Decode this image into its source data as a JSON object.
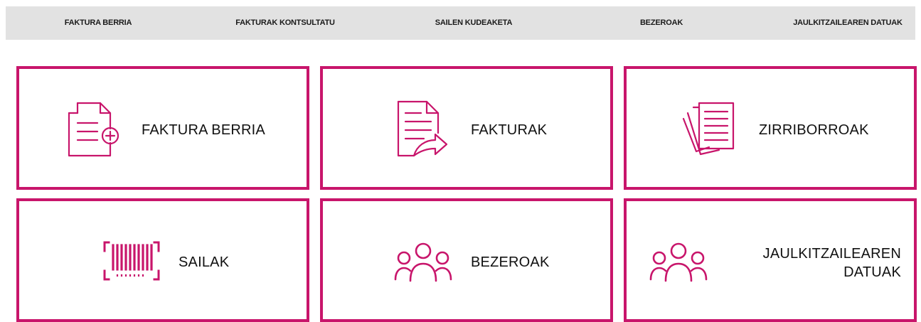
{
  "nav": {
    "items": [
      {
        "label": "FAKTURA BERRIA"
      },
      {
        "label": "FAKTURAK KONTSULTATU"
      },
      {
        "label": "SAILEN KUDEAKETA"
      },
      {
        "label": "BEZEROAK"
      },
      {
        "label": "JAULKITZAILEAREN DATUAK"
      }
    ]
  },
  "cards": [
    {
      "label": "FAKTURA BERRIA",
      "icon": "new-invoice-icon"
    },
    {
      "label": "FAKTURAK",
      "icon": "invoice-send-icon"
    },
    {
      "label": "ZIRRIBORROAK",
      "icon": "drafts-icon"
    },
    {
      "label": "SAILAK",
      "icon": "barcode-icon"
    },
    {
      "label": "BEZEROAK",
      "icon": "customers-icon"
    },
    {
      "label": "JAULKITZAILEAREN DATUAK",
      "icon": "issuer-people-icon"
    }
  ],
  "colors": {
    "accent": "#c8156b",
    "nav_background": "#e2e2e2"
  }
}
